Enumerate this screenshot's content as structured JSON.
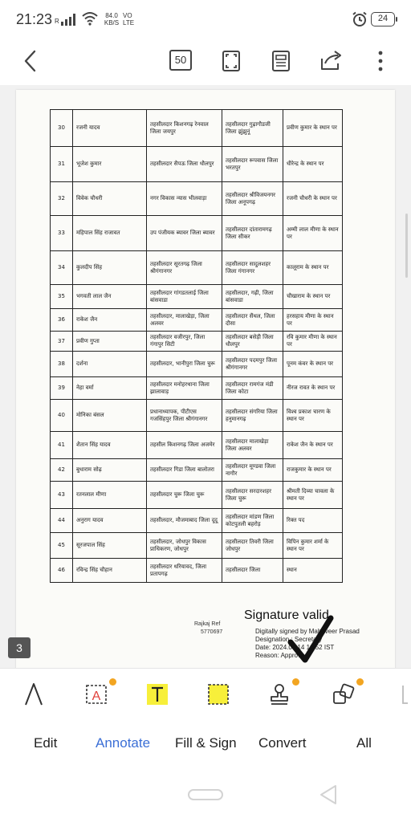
{
  "status_bar": {
    "time": "21:23",
    "network_r": "R",
    "speed_value": "84.0",
    "speed_unit": "KB/S",
    "volte_top": "VO",
    "volte_bottom": "LTE",
    "battery": "24",
    "icons": [
      "signal-icon",
      "wifi-icon",
      "alarm-icon",
      "battery-icon"
    ]
  },
  "toolbar": {
    "page_count": "50",
    "icons": [
      "back-arrow-icon",
      "page-count-icon",
      "fullscreen-icon",
      "reader-mode-icon",
      "share-icon",
      "more-vertical-icon"
    ]
  },
  "document": {
    "rows": [
      {
        "sno": "30",
        "name": "रजनी यादव",
        "from": "तहसीलदार किशनगढ़ रेनवाल जिला जयपुर",
        "to": "तहसीलदार गुढ़ागौडजी जिला झुंझुनूं",
        "remark": "प्रवीण कुमार के स्थान पर"
      },
      {
        "sno": "31",
        "name": "भूजेश कुमार",
        "from": "तहसीलदार सैपऊ जिला धौलपुर",
        "to": "तहसीलदार रूपवास जिला भरतपुर",
        "remark": "धीरेन्द्र के स्थान पर"
      },
      {
        "sno": "32",
        "name": "विवेक चौधरी",
        "from": "नगर विकास न्यास भीलवाड़ा",
        "to": "तहसीलदार श्रीविजयनगर जिला अनूपगढ़",
        "remark": "रजनी चौधरी के स्थान पर"
      },
      {
        "sno": "33",
        "name": "महिपाल सिंह राजावत",
        "from": "उप पंजीयक ब्यावर जिला ब्यावर",
        "to": "तहसीलदार दांतारामगढ़ जिला सीकर",
        "remark": "अम्मी लाल मीणा के स्थान पर"
      },
      {
        "sno": "34",
        "name": "कुलदीप सिंह",
        "from": "तहसीलदार सूरतगढ़ जिला श्रीगंगानगर",
        "to": "तहसीलदार सादुलशहर जिला गंगानगर",
        "remark": "कालूराम के स्थान पर"
      },
      {
        "sno": "35",
        "name": "भगवती लाल जैन",
        "from": "तहसीलदार गांगडतलाई जिला बांसवाडा",
        "to": "तहसीलदार, गढ़ी, जिला बांसवाडा",
        "remark": "चौखाराम के स्थान पर"
      },
      {
        "sno": "36",
        "name": "राकेश जैन",
        "from": "तहसीलदार, मालाखेड़ा, जिला अलवर",
        "to": "तहसीलदार सैंथल, जिला दौसा",
        "remark": "हरसहाय मीणा के स्थान पर"
      },
      {
        "sno": "37",
        "name": "प्रवीण गुप्ता",
        "from": "तहसीलदार वजीरपुर, जिला गंगापुर सिटी",
        "to": "तहसीलदार बसेड़ी जिला धौलपुर",
        "remark": "रवि कुमार मीणा के स्थान पर"
      },
      {
        "sno": "38",
        "name": "दर्शना",
        "from": "तहसीलदार, भानीपुरा जिला चुरू",
        "to": "तहसीलदार पदमपुर जिला श्रीगंगानगर",
        "remark": "पूनम कंवर के स्थान पर"
      },
      {
        "sno": "39",
        "name": "नेहा वर्मा",
        "from": "तहसीलदार मनोहरथाना जिला झालावाड़",
        "to": "तहसीलदार रामगंज मंडी जिला कोटा",
        "remark": "नीरज रावत के स्थान पर"
      },
      {
        "sno": "40",
        "name": "मोनिका बंसल",
        "from": "प्रधानाध्यापक, पीटीएस गजसिंहपुर जिला श्रीगंगानगर",
        "to": "तहसीलदार संगरिया जिला हनुमानगढ़",
        "remark": "विश्व प्रकाश चारण के स्थान पर"
      },
      {
        "sno": "41",
        "name": "शैतान सिंह यादव",
        "from": "तहसील किशनगढ़ जिला अजमेर",
        "to": "तहसीलदार मालाखेड़ा जिला अलवर",
        "remark": "राकेश जैन के स्थान पर"
      },
      {
        "sno": "42",
        "name": "बुधाराम सोढ़",
        "from": "तहसीलदार गिडा जिला बालोतरा",
        "to": "तहसीलदार मूण्डवा जिला नागौर",
        "remark": "राजकुमार के स्थान पर"
      },
      {
        "sno": "43",
        "name": "रतनलाल मीणा",
        "from": "तहसीलदार चुरू जिला चुरू",
        "to": "तहसीलदार सरदारशहर जिला चुरू",
        "remark": "श्रीमती दिव्या चावला के स्थान पर"
      },
      {
        "sno": "44",
        "name": "अनुराग यादव",
        "from": "तहसीलदार, मौजमाबाद जिला दूदू",
        "to": "तहसीलदार मांडण जिला कोटपुतली बहरोड़",
        "remark": "रिक्त पद"
      },
      {
        "sno": "45",
        "name": "सूरजपाल सिंह",
        "from": "तहसीलदार, जोधपुर विकास प्राधिकरण, जोधपुर",
        "to": "तहसीलदार तिवरी जिला जोधपुर",
        "remark": "विपिन कुमार शर्मा के स्थान पर"
      },
      {
        "sno": "46",
        "name": "रविन्द्र सिंह चौहान",
        "from": "तहसीलदार धरियावद, जिला प्रतापगढ़",
        "to": "तहसीलदार जिला",
        "remark": "स्थान"
      }
    ],
    "signature": {
      "title": "Signature valid",
      "line1": "Digitally signed by Mahaveer Prasad",
      "line2": "Designation : Secretary",
      "line3": "Date: 2024.04.14 16:52 IST",
      "line4": "Reason: Approved",
      "signer_left": "Rajkaj Ref",
      "signer_num": "5770697"
    },
    "current_page": "3"
  },
  "annotation_tools": {
    "icons": [
      "ink-pen-icon",
      "text-box-icon",
      "highlight-text-icon",
      "area-highlight-icon",
      "stamp-icon",
      "shape-icon",
      "eraser-icon"
    ],
    "accent_highlight": "#f7ef3a",
    "crown_color": "#f2a521"
  },
  "bottom_tabs": {
    "edit": "Edit",
    "annotate": "Annotate",
    "fill_sign": "Fill & Sign",
    "convert": "Convert",
    "all": "All",
    "active": "Annotate",
    "active_color": "#3b6fd6"
  },
  "nav_bar": {
    "icons": [
      "home-pill-icon",
      "back-triangle-icon"
    ]
  }
}
